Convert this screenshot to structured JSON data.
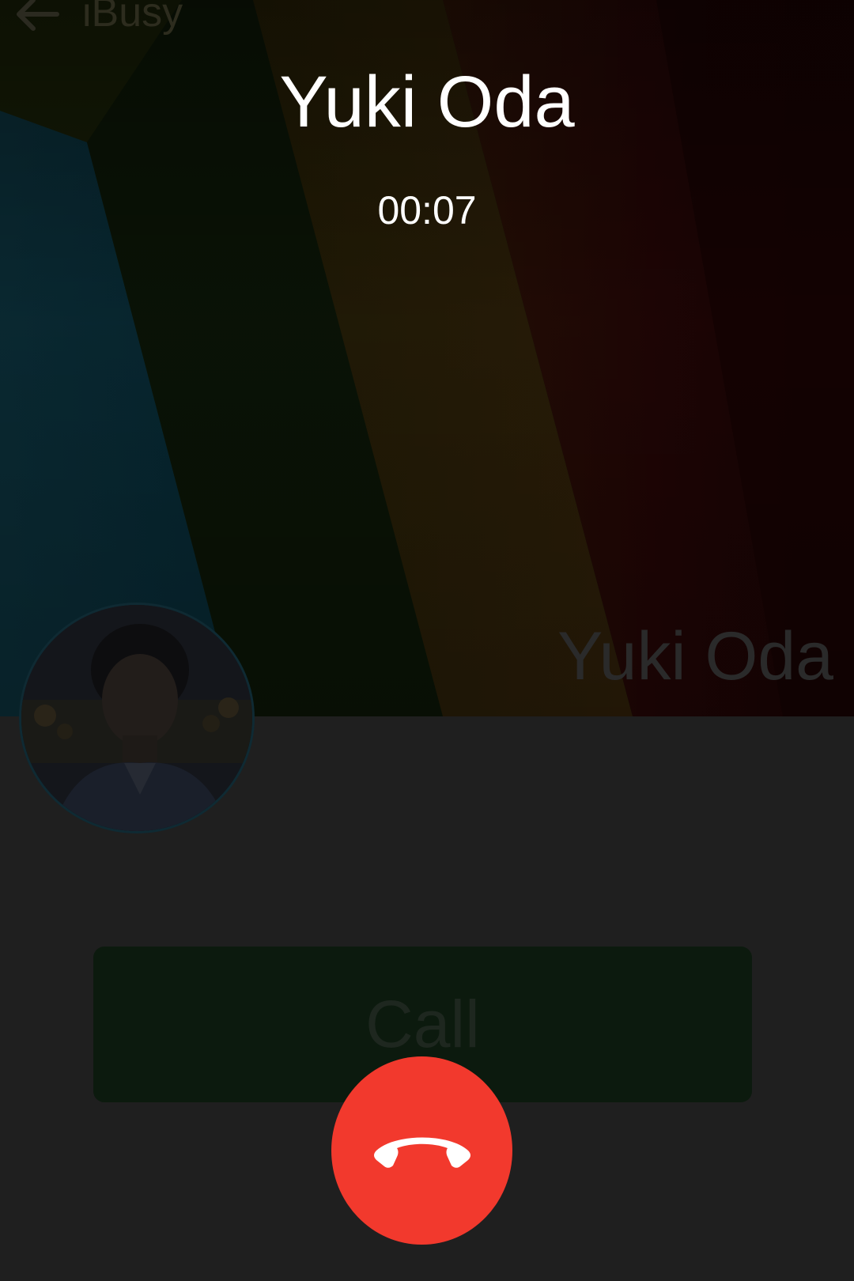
{
  "background_app": {
    "title": "iBusy",
    "back_icon": "arrow-left-icon",
    "contact_name": "Yuki Oda",
    "call_button_label": "Call"
  },
  "in_call": {
    "caller_name": "Yuki Oda",
    "duration": "00:07",
    "end_call_icon": "phone-hangup-icon",
    "end_call_color": "#f2392d"
  },
  "colors": {
    "overlay_background": "#1f1f1f",
    "call_button_dimmed": "#0c1a0e",
    "text_primary": "#ffffff"
  }
}
